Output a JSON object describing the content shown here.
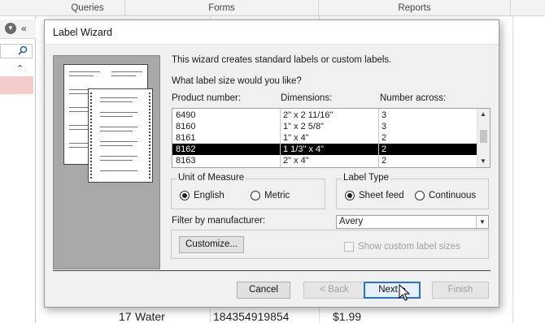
{
  "ribbon": {
    "tabs": [
      "Queries",
      "Forms",
      "Reports"
    ]
  },
  "nav": {
    "dropdown_icon": "chevron-down-circle-icon",
    "collapse_icon": "double-chevron-left-icon",
    "search_icon": "search-icon"
  },
  "background_row": {
    "id": "17",
    "name": "Water",
    "code": "184354919854",
    "price": "$1.99"
  },
  "dialog": {
    "title": "Label Wizard",
    "intro": "This wizard creates standard labels or custom labels.",
    "question": "What label size would you like?",
    "columns": {
      "product": "Product number:",
      "dimensions": "Dimensions:",
      "across": "Number across:"
    },
    "rows": [
      {
        "product": "6490",
        "dimensions": "2\" x 2 11/16\"",
        "across": "3"
      },
      {
        "product": "8160",
        "dimensions": "1\" x 2 5/8\"",
        "across": "3"
      },
      {
        "product": "8161",
        "dimensions": "1\" x 4\"",
        "across": "2"
      },
      {
        "product": "8162",
        "dimensions": "1 1/3\" x 4\"",
        "across": "2"
      },
      {
        "product": "8163",
        "dimensions": "2\" x 4\"",
        "across": "2"
      }
    ],
    "selected_row": 3,
    "unit_of_measure": {
      "title": "Unit of Measure",
      "english": "English",
      "metric": "Metric",
      "selected": "English"
    },
    "label_type": {
      "title": "Label Type",
      "sheet": "Sheet feed",
      "continuous": "Continuous",
      "selected": "Sheet feed"
    },
    "filter": {
      "label": "Filter by  manufacturer:",
      "value": "Avery"
    },
    "customize_label": "Customize...",
    "show_custom_label": "Show custom label sizes",
    "buttons": {
      "cancel": "Cancel",
      "back": "< Back",
      "next": "Next >",
      "finish": "Finish"
    }
  }
}
